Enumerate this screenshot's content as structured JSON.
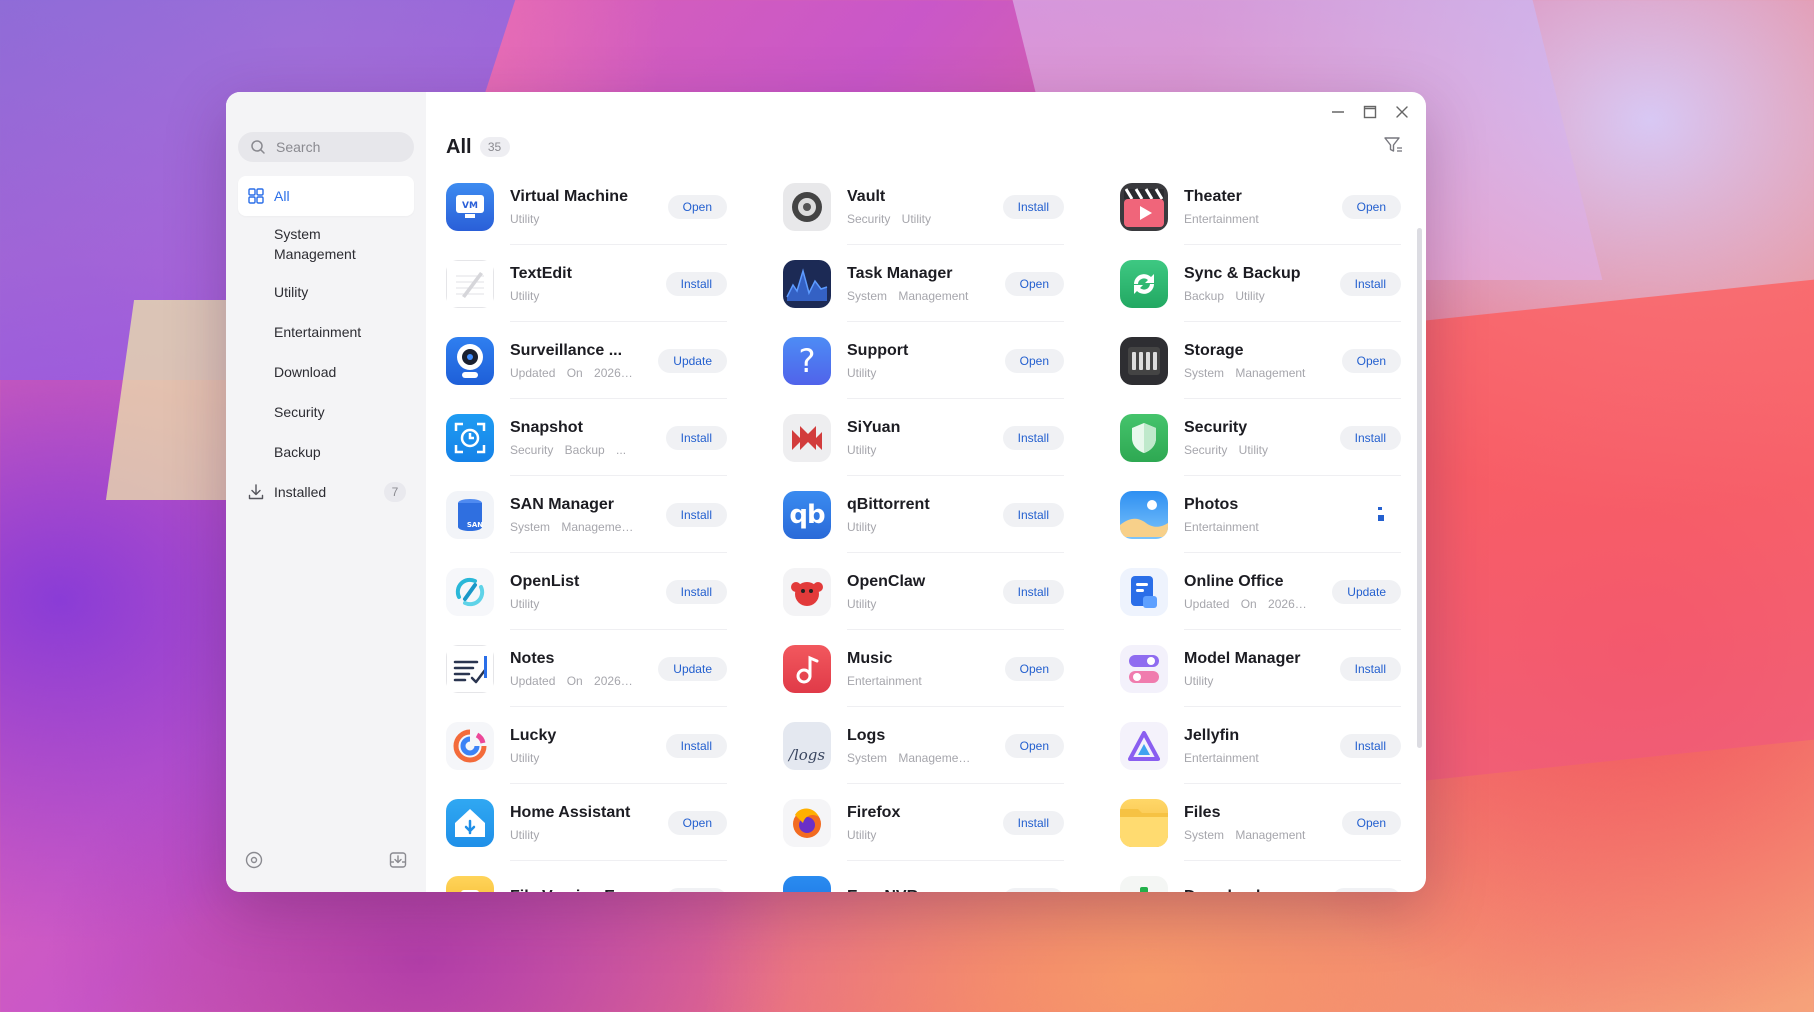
{
  "sidebar": {
    "search_placeholder": "Search",
    "items": [
      {
        "label": "All",
        "active": true
      },
      {
        "label": "System Management"
      },
      {
        "label": "Utility"
      },
      {
        "label": "Entertainment"
      },
      {
        "label": "Download"
      },
      {
        "label": "Security"
      },
      {
        "label": "Backup"
      },
      {
        "label": "Installed",
        "count": "7"
      }
    ]
  },
  "main": {
    "title": "All",
    "count": "35"
  },
  "apps": [
    {
      "name": "Virtual Machine",
      "tags": "Utility",
      "action": "Open",
      "icon": "virtual-machine-icon"
    },
    {
      "name": "Vault",
      "tags": "Security  Utility",
      "action": "Install",
      "icon": "vault-icon"
    },
    {
      "name": "Theater",
      "tags": "Entertainment",
      "action": "Open",
      "icon": "theater-icon"
    },
    {
      "name": "TextEdit",
      "tags": "Utility",
      "action": "Install",
      "icon": "textedit-icon"
    },
    {
      "name": "Task Manager",
      "tags": "System Management",
      "action": "Open",
      "icon": "task-manager-icon"
    },
    {
      "name": "Sync & Backup",
      "tags": "Backup  Utility",
      "action": "Install",
      "icon": "sync-backup-icon"
    },
    {
      "name": "Surveillance ...",
      "tags": "Updated On 2026-0...",
      "action": "Update",
      "icon": "surveillance-icon"
    },
    {
      "name": "Support",
      "tags": "Utility",
      "action": "Open",
      "icon": "support-icon"
    },
    {
      "name": "Storage",
      "tags": "System Management",
      "action": "Open",
      "icon": "storage-icon"
    },
    {
      "name": "Snapshot",
      "tags": "Security  Backup  ...",
      "action": "Install",
      "icon": "snapshot-icon"
    },
    {
      "name": "SiYuan",
      "tags": "Utility",
      "action": "Install",
      "icon": "siyuan-icon"
    },
    {
      "name": "Security",
      "tags": "Security  Utility",
      "action": "Install",
      "icon": "security-shield-icon"
    },
    {
      "name": "SAN Manager",
      "tags": "System Managemen...",
      "action": "Install",
      "icon": "san-manager-icon"
    },
    {
      "name": "qBittorrent",
      "tags": "Utility",
      "action": "Install",
      "icon": "qbittorrent-icon"
    },
    {
      "name": "Photos",
      "tags": "Entertainment",
      "action": "",
      "icon": "photos-icon"
    },
    {
      "name": "OpenList",
      "tags": "Utility",
      "action": "Install",
      "icon": "openlist-icon"
    },
    {
      "name": "OpenClaw",
      "tags": "Utility",
      "action": "Install",
      "icon": "openclaw-icon"
    },
    {
      "name": "Online Office",
      "tags": "Updated On 2026-0...",
      "action": "Update",
      "icon": "online-office-icon"
    },
    {
      "name": "Notes",
      "tags": "Updated On 2026-0...",
      "action": "Update",
      "icon": "notes-icon"
    },
    {
      "name": "Music",
      "tags": "Entertainment",
      "action": "Open",
      "icon": "music-icon"
    },
    {
      "name": "Model Manager",
      "tags": "Utility",
      "action": "Install",
      "icon": "model-manager-icon"
    },
    {
      "name": "Lucky",
      "tags": "Utility",
      "action": "Install",
      "icon": "lucky-icon"
    },
    {
      "name": "Logs",
      "tags": "System Management...",
      "action": "Open",
      "icon": "logs-icon"
    },
    {
      "name": "Jellyfin",
      "tags": "Entertainment",
      "action": "Install",
      "icon": "jellyfin-icon"
    },
    {
      "name": "Home Assistant",
      "tags": "Utility",
      "action": "Open",
      "icon": "home-assistant-icon"
    },
    {
      "name": "Firefox",
      "tags": "Utility",
      "action": "Install",
      "icon": "firefox-icon"
    },
    {
      "name": "Files",
      "tags": "System Management",
      "action": "Open",
      "icon": "files-folder-icon"
    },
    {
      "name": "File Version Ex...",
      "tags": "",
      "action": "Install",
      "icon": "file-version-icon"
    },
    {
      "name": "EasyNVR",
      "tags": "",
      "action": "Install",
      "icon": "easynvr-icon"
    },
    {
      "name": "Downloads",
      "tags": "",
      "action": "Update",
      "icon": "downloads-icon"
    }
  ],
  "colors": {
    "accent": "#2460cf",
    "sidebar_bg": "#f4f4f6",
    "button_bg": "#f0f1f4"
  }
}
